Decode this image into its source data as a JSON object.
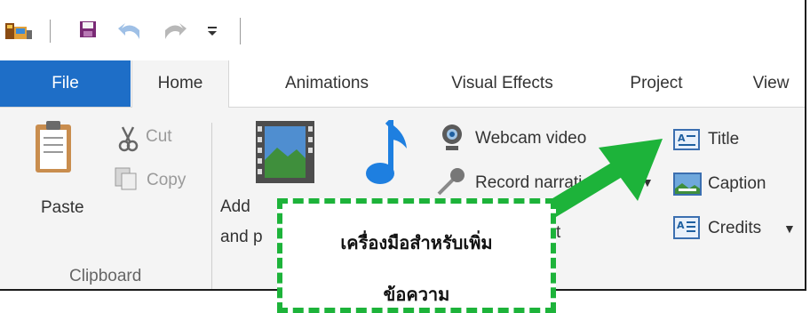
{
  "tabs": {
    "file": "File",
    "home": "Home",
    "animations": "Animations",
    "visual_effects": "Visual Effects",
    "project": "Project",
    "view": "View"
  },
  "clipboard": {
    "paste": "Paste",
    "cut": "Cut",
    "copy": "Copy",
    "group_label": "Clipboard"
  },
  "add": {
    "line1": "Add",
    "line2": "and p"
  },
  "media": {
    "webcam": "Webcam video",
    "record": "Record narration",
    "snapshot_tail": "t"
  },
  "text_tools": {
    "title": "Title",
    "caption": "Caption",
    "credits": "Credits"
  },
  "annotation": {
    "line1": "เครื่องมือสำหรับเพิ่ม",
    "line2": "ข้อความ"
  },
  "colors": {
    "file_tab": "#1e6ec7",
    "highlight_green": "#1db33a"
  }
}
